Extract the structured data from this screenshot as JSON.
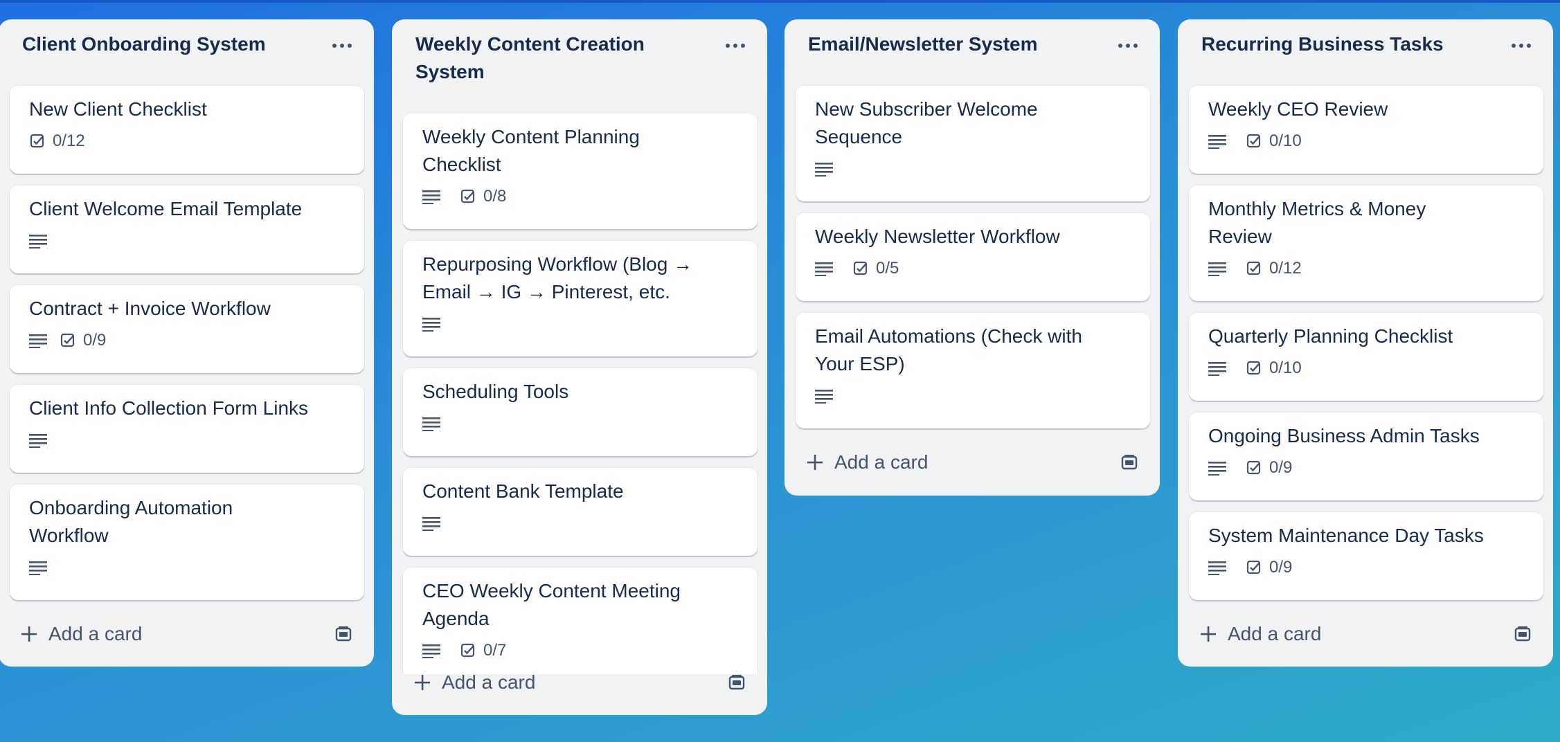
{
  "lists": [
    {
      "title": "Client Onboarding System",
      "add_label": "Add a card",
      "cards": [
        {
          "title": "New Client Checklist",
          "checklist": "0/12"
        },
        {
          "title": "Client Welcome Email Template"
        },
        {
          "title": "Contract + Invoice Workflow",
          "checklist": "0/9"
        },
        {
          "title": "Client Info Collection Form Links"
        },
        {
          "title": "Onboarding Automation Workflow"
        }
      ]
    },
    {
      "title": "Weekly Content Creation System",
      "add_label": "Add a card",
      "cards": [
        {
          "title": "Weekly Content Planning Checklist",
          "checklist": "0/8"
        },
        {
          "title": "Repurposing Workflow (Blog → Email → IG → Pinterest, etc."
        },
        {
          "title": "Scheduling Tools"
        },
        {
          "title": "Content Bank Template"
        },
        {
          "title": "CEO Weekly Content Meeting Agenda",
          "checklist": "0/7"
        }
      ]
    },
    {
      "title": "Email/Newsletter System",
      "add_label": "Add a card",
      "cards": [
        {
          "title": "New Subscriber Welcome Sequence"
        },
        {
          "title": "Weekly Newsletter Workflow",
          "checklist": "0/5"
        },
        {
          "title": "Email Automations (Check with Your ESP)"
        }
      ]
    },
    {
      "title": "Recurring Business Tasks",
      "add_label": "Add a card",
      "cards": [
        {
          "title": "Weekly CEO Review",
          "checklist": "0/10"
        },
        {
          "title": "Monthly Metrics & Money Review",
          "checklist": "0/12"
        },
        {
          "title": "Quarterly Planning Checklist",
          "checklist": "0/10"
        },
        {
          "title": "Ongoing Business Admin Tasks",
          "checklist": "0/9"
        },
        {
          "title": "System Maintenance Day Tasks",
          "checklist": "0/9"
        }
      ]
    }
  ]
}
